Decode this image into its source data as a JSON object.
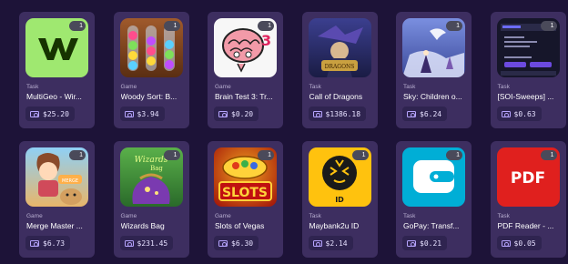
{
  "cards": [
    {
      "kind": "Task",
      "title": "MultiGeo - Wir...",
      "price": "$25.20",
      "badge": "1",
      "icon": "wise-logo-icon",
      "color": "#9fe870"
    },
    {
      "kind": "Game",
      "title": "Woody Sort: B...",
      "price": "$3.94",
      "badge": "1",
      "icon": "sort-tubes-icon",
      "color": "#6a3a1a"
    },
    {
      "kind": "Game",
      "title": "Brain Test 3: Tr...",
      "price": "$0.20",
      "badge": "1",
      "icon": "brain-icon",
      "color": "#f4f4f4"
    },
    {
      "kind": "Task",
      "title": "Call of Dragons",
      "price": "$1386.18",
      "badge": "",
      "icon": "dragons-icon",
      "color": "#2a2e6a"
    },
    {
      "kind": "Task",
      "title": "Sky: Children o...",
      "price": "$6.24",
      "badge": "1",
      "icon": "sky-icon",
      "color": "#5b6ec2"
    },
    {
      "kind": "Task",
      "title": "[SOI-Sweeps] ...",
      "price": "$0.63",
      "badge": "1",
      "icon": "screenshot-icon",
      "color": "#1c1c2e"
    },
    {
      "kind": "Game",
      "title": "Merge Master ...",
      "price": "$6.73",
      "badge": "1",
      "icon": "merge-master-icon",
      "color": "#6bb6e8"
    },
    {
      "kind": "Game",
      "title": "Wizards Bag",
      "price": "$231.45",
      "badge": "1",
      "icon": "wizards-bag-icon",
      "color": "#4a9a3a"
    },
    {
      "kind": "Game",
      "title": "Slots of Vegas",
      "price": "$6.30",
      "badge": "1",
      "icon": "slots-icon",
      "color": "#b0140c"
    },
    {
      "kind": "Task",
      "title": "Maybank2u ID",
      "price": "$2.14",
      "badge": "1",
      "icon": "maybank-tiger-icon",
      "color": "#ffc20e"
    },
    {
      "kind": "Task",
      "title": "GoPay: Transf...",
      "price": "$0.21",
      "badge": "1",
      "icon": "gopay-wallet-icon",
      "color": "#00aed6"
    },
    {
      "kind": "Task",
      "title": "PDF Reader - ...",
      "price": "$0.05",
      "badge": "1",
      "icon": "pdf-icon",
      "color": "#e0201e"
    }
  ]
}
